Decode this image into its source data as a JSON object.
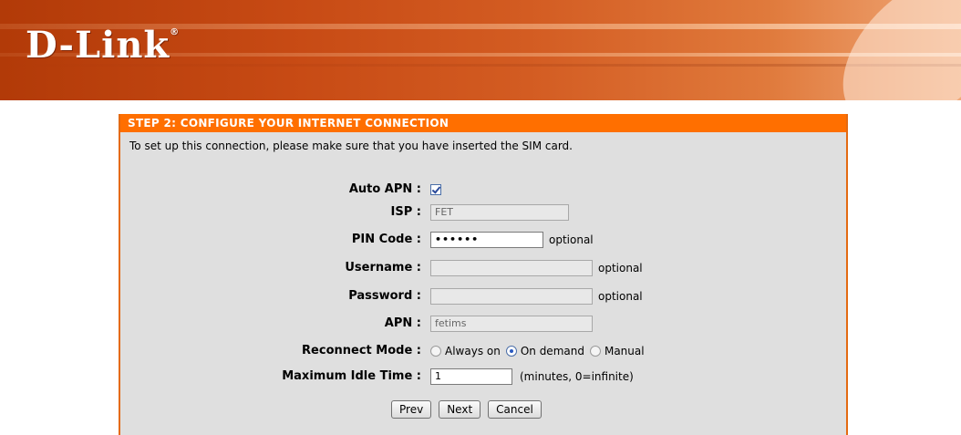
{
  "header": {
    "logo_text": "D-Link",
    "logo_mark": "®"
  },
  "panel": {
    "title": "STEP 2: CONFIGURE YOUR INTERNET CONNECTION",
    "intro": "To set up this connection, please make sure that you have inserted the SIM card."
  },
  "form": {
    "auto_apn": {
      "label": "Auto APN :",
      "checked": true
    },
    "isp": {
      "label": "ISP :",
      "value": "FET"
    },
    "pin_code": {
      "label": "PIN Code :",
      "value": "••••••",
      "hint": "optional"
    },
    "username": {
      "label": "Username :",
      "value": "",
      "hint": "optional"
    },
    "password": {
      "label": "Password :",
      "value": "",
      "hint": "optional"
    },
    "apn": {
      "label": "APN :",
      "value": "fetims"
    },
    "reconnect_mode": {
      "label": "Reconnect Mode :",
      "options": [
        "Always on",
        "On demand",
        "Manual"
      ],
      "selected": "On demand"
    },
    "max_idle": {
      "label": "Maximum Idle Time :",
      "value": "1",
      "hint": "(minutes, 0=infinite)"
    }
  },
  "buttons": {
    "prev": "Prev",
    "next": "Next",
    "cancel": "Cancel"
  },
  "colors": {
    "accent": "#ff6f00",
    "panel_bg": "#dfdfdf"
  }
}
